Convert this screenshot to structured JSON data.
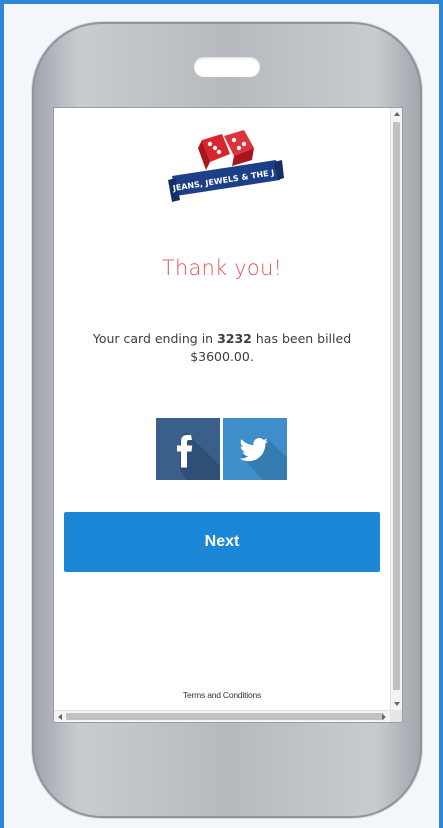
{
  "brand": {
    "name": "JEANS, JEWELS & THE J",
    "colors": {
      "banner": "#1c3f87",
      "dice": "#d8242c"
    }
  },
  "confirmation": {
    "heading": "Thank you!",
    "message_prefix": "Your card ending in",
    "card_last4": "3232",
    "message_middle": "has been billed",
    "amount": "$3600.00."
  },
  "share": {
    "facebook_icon": "facebook-icon",
    "twitter_icon": "twitter-icon",
    "colors": {
      "facebook": "#3b5f8b",
      "twitter": "#3e8ecb"
    }
  },
  "actions": {
    "next_label": "Next",
    "next_color": "#1b87d6"
  },
  "footer": {
    "terms_label": "Terms and Conditions"
  }
}
